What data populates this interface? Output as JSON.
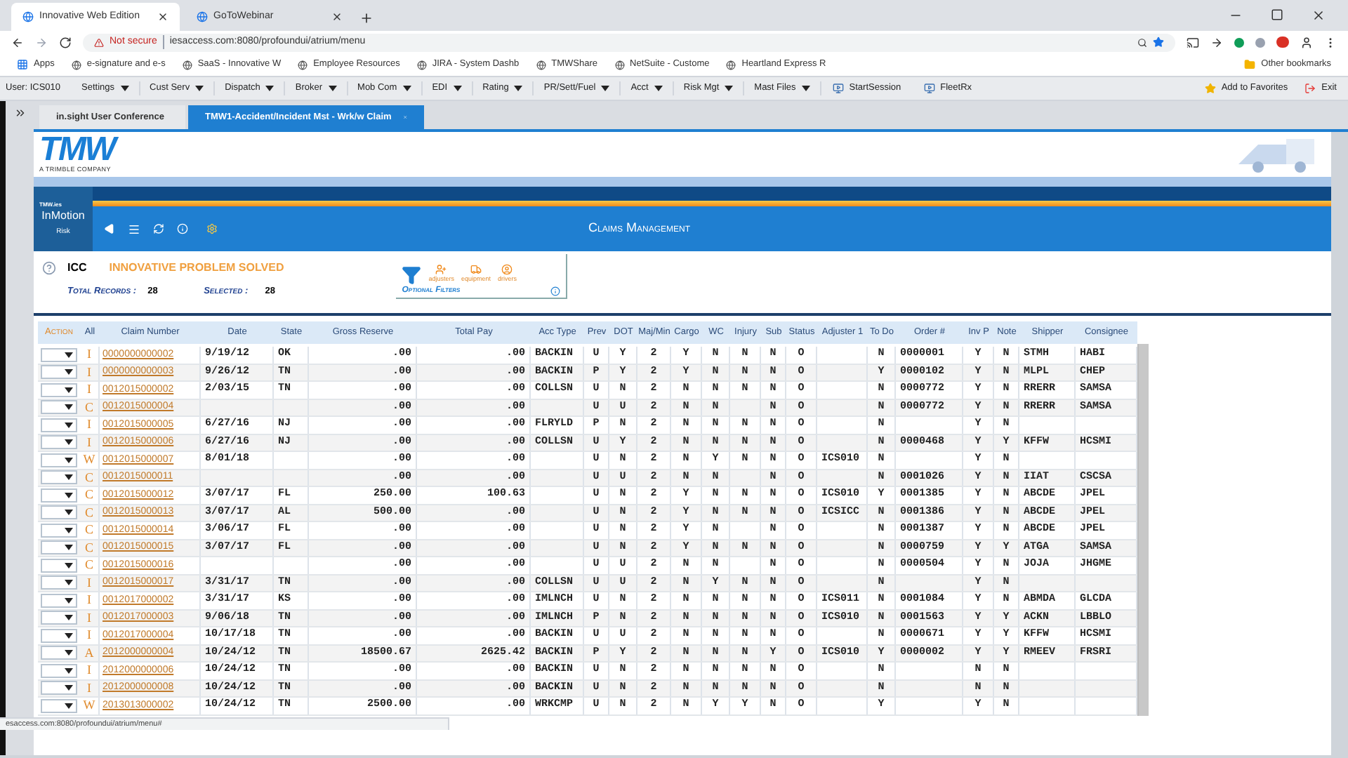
{
  "browser": {
    "tabs": [
      {
        "label": "Innovative Web Edition",
        "selected": true
      },
      {
        "label": "GoToWebinar",
        "selected": false
      }
    ],
    "security": "Not secure",
    "url": "iesaccess.com:8080/profoundui/atrium/menu",
    "bookmarks": [
      "Apps",
      "e-signature and e-s",
      "SaaS - Innovative W",
      "Employee Resources",
      "JIRA - System Dashb",
      "TMWShare",
      "NetSuite - Custome",
      "Heartland Express R"
    ],
    "other_bookmarks": "Other bookmarks",
    "status_url": "esaccess.com:8080/profoundui/atrium/menu#"
  },
  "menu_bar": {
    "user": "User: ICS010",
    "items": [
      {
        "label": "Settings",
        "has_menu": true
      },
      {
        "label": "Cust Serv",
        "has_menu": true
      },
      {
        "label": "Dispatch",
        "has_menu": true
      },
      {
        "label": "Broker",
        "has_menu": true
      },
      {
        "label": "Mob Com",
        "has_menu": true
      },
      {
        "label": "EDI",
        "has_menu": true
      },
      {
        "label": "Rating",
        "has_menu": true
      },
      {
        "label": "PR/Sett/Fuel",
        "has_menu": true
      },
      {
        "label": "Acct",
        "has_menu": true
      },
      {
        "label": "Risk Mgt",
        "has_menu": true
      },
      {
        "label": "Mast Files",
        "has_menu": true
      }
    ],
    "links": [
      "StartSession",
      "FleetRx"
    ],
    "favorites": "Add to Favorites",
    "exit": "Exit"
  },
  "app_tabs": [
    {
      "label": "in.sight User Conference",
      "selected": false
    },
    {
      "label": "TMW1-Accident/Incident Mst - Wrk/w Claim",
      "selected": true
    }
  ],
  "header": {
    "logo": "TMW",
    "logo_tagline": "A TRIMBLE COMPANY",
    "module_brand": "TMW.ies",
    "module_name": "InMotion",
    "module_sub": "Risk",
    "title": "Claims Management"
  },
  "summary": {
    "code": "ICC",
    "company": "INNOVATIVE PROBLEM SOLVED",
    "total_label": "Total Records :",
    "total": "28",
    "selected_label": "Selected :",
    "selected": "28"
  },
  "filters": {
    "items": [
      "adjusters",
      "equipment",
      "drivers"
    ],
    "label": "Optional Filters"
  },
  "table": {
    "columns": [
      "Action",
      "All",
      "Claim Number",
      "Date",
      "State",
      "Gross Reserve",
      "Total Pay",
      "Acc Type",
      "Prev",
      "DOT",
      "Maj/Min",
      "Cargo",
      "WC",
      "Injury",
      "Sub",
      "Status",
      "Adjuster 1",
      "To Do",
      "Order #",
      "Inv P",
      "Note",
      "Shipper",
      "Consignee"
    ],
    "rows": [
      {
        "cells": [
          "",
          "I",
          "0000000000002",
          "9/19/12",
          "OK",
          ".00",
          ".00",
          "BACKIN",
          "U",
          "Y",
          "2",
          "Y",
          "N",
          "N",
          "N",
          "O",
          "",
          "N",
          "0000001",
          "Y",
          "N",
          "STMH",
          "HABI"
        ]
      },
      {
        "cells": [
          "",
          "I",
          "0000000000003",
          "9/26/12",
          "TN",
          ".00",
          ".00",
          "BACKIN",
          "P",
          "Y",
          "2",
          "Y",
          "N",
          "N",
          "N",
          "O",
          "",
          "Y",
          "0000102",
          "Y",
          "N",
          "MLPL",
          "CHEP"
        ]
      },
      {
        "cells": [
          "",
          "I",
          "0012015000002",
          "2/03/15",
          "TN",
          ".00",
          ".00",
          "COLLSN",
          "U",
          "N",
          "2",
          "N",
          "N",
          "N",
          "N",
          "O",
          "",
          "N",
          "0000772",
          "Y",
          "N",
          "RRERR",
          "SAMSA"
        ]
      },
      {
        "cells": [
          "",
          "C",
          "0012015000004",
          "",
          "",
          ".00",
          ".00",
          "",
          "U",
          "U",
          "2",
          "N",
          "N",
          "",
          "N",
          "O",
          "",
          "N",
          "0000772",
          "Y",
          "N",
          "RRERR",
          "SAMSA"
        ]
      },
      {
        "cells": [
          "",
          "I",
          "0012015000005",
          "6/27/16",
          "NJ",
          ".00",
          ".00",
          "FLRYLD",
          "P",
          "N",
          "2",
          "N",
          "N",
          "N",
          "N",
          "O",
          "",
          "N",
          "",
          "Y",
          "N",
          "",
          ""
        ]
      },
      {
        "cells": [
          "",
          "I",
          "0012015000006",
          "6/27/16",
          "NJ",
          ".00",
          ".00",
          "COLLSN",
          "U",
          "Y",
          "2",
          "N",
          "N",
          "N",
          "N",
          "O",
          "",
          "N",
          "0000468",
          "Y",
          "Y",
          "KFFW",
          "HCSMI"
        ]
      },
      {
        "cells": [
          "",
          "W",
          "0012015000007",
          "8/01/18",
          "",
          ".00",
          ".00",
          "",
          "U",
          "N",
          "2",
          "N",
          "Y",
          "N",
          "N",
          "O",
          "ICS010",
          "N",
          "",
          "Y",
          "N",
          "",
          ""
        ]
      },
      {
        "cells": [
          "",
          "C",
          "0012015000011",
          "",
          "",
          ".00",
          ".00",
          "",
          "U",
          "U",
          "2",
          "N",
          "N",
          "",
          "N",
          "O",
          "",
          "N",
          "0001026",
          "Y",
          "N",
          "IIAT",
          "CSCSA"
        ]
      },
      {
        "cells": [
          "",
          "C",
          "0012015000012",
          "3/07/17",
          "FL",
          "250.00",
          "100.63",
          "",
          "U",
          "N",
          "2",
          "Y",
          "N",
          "N",
          "N",
          "O",
          "ICS010",
          "Y",
          "0001385",
          "Y",
          "N",
          "ABCDE",
          "JPEL"
        ]
      },
      {
        "cells": [
          "",
          "C",
          "0012015000013",
          "3/07/17",
          "AL",
          "500.00",
          ".00",
          "",
          "U",
          "N",
          "2",
          "Y",
          "N",
          "N",
          "N",
          "O",
          "ICSICC",
          "N",
          "0001386",
          "Y",
          "N",
          "ABCDE",
          "JPEL"
        ]
      },
      {
        "cells": [
          "",
          "C",
          "0012015000014",
          "3/06/17",
          "FL",
          ".00",
          ".00",
          "",
          "U",
          "N",
          "2",
          "Y",
          "N",
          "",
          "N",
          "O",
          "",
          "N",
          "0001387",
          "Y",
          "N",
          "ABCDE",
          "JPEL"
        ]
      },
      {
        "cells": [
          "",
          "C",
          "0012015000015",
          "3/07/17",
          "FL",
          ".00",
          ".00",
          "",
          "U",
          "N",
          "2",
          "Y",
          "N",
          "N",
          "N",
          "O",
          "",
          "N",
          "0000759",
          "Y",
          "Y",
          "ATGA",
          "SAMSA"
        ]
      },
      {
        "cells": [
          "",
          "C",
          "0012015000016",
          "",
          "",
          ".00",
          ".00",
          "",
          "U",
          "U",
          "2",
          "N",
          "N",
          "",
          "N",
          "O",
          "",
          "N",
          "0000504",
          "Y",
          "N",
          "JOJA",
          "JHGME"
        ]
      },
      {
        "cells": [
          "",
          "I",
          "0012015000017",
          "3/31/17",
          "TN",
          ".00",
          ".00",
          "COLLSN",
          "U",
          "U",
          "2",
          "N",
          "Y",
          "N",
          "N",
          "O",
          "",
          "N",
          "",
          "Y",
          "N",
          "",
          ""
        ]
      },
      {
        "cells": [
          "",
          "I",
          "0012017000002",
          "3/31/17",
          "KS",
          ".00",
          ".00",
          "IMLNCH",
          "U",
          "N",
          "2",
          "N",
          "N",
          "N",
          "N",
          "O",
          "ICS011",
          "N",
          "0001084",
          "Y",
          "N",
          "ABMDA",
          "GLCDA"
        ]
      },
      {
        "cells": [
          "",
          "I",
          "0012017000003",
          "9/06/18",
          "TN",
          ".00",
          ".00",
          "IMLNCH",
          "P",
          "N",
          "2",
          "N",
          "N",
          "N",
          "N",
          "O",
          "ICS010",
          "N",
          "0001563",
          "Y",
          "Y",
          "ACKN",
          "LBBLO"
        ]
      },
      {
        "cells": [
          "",
          "I",
          "0012017000004",
          "10/17/18",
          "TN",
          ".00",
          ".00",
          "BACKIN",
          "U",
          "U",
          "2",
          "N",
          "N",
          "N",
          "N",
          "O",
          "",
          "N",
          "0000671",
          "Y",
          "Y",
          "KFFW",
          "HCSMI"
        ]
      },
      {
        "cells": [
          "",
          "A",
          "2012000000004",
          "10/24/12",
          "TN",
          "18500.67",
          "2625.42",
          "BACKIN",
          "P",
          "Y",
          "2",
          "N",
          "N",
          "N",
          "Y",
          "O",
          "ICS010",
          "Y",
          "0000002",
          "Y",
          "Y",
          "RMEEV",
          "FRSRI"
        ]
      },
      {
        "cells": [
          "",
          "I",
          "2012000000006",
          "10/24/12",
          "TN",
          ".00",
          ".00",
          "BACKIN",
          "U",
          "N",
          "2",
          "N",
          "N",
          "N",
          "N",
          "O",
          "",
          "N",
          "",
          "N",
          "N",
          "",
          ""
        ]
      },
      {
        "cells": [
          "",
          "I",
          "2012000000008",
          "10/24/12",
          "TN",
          ".00",
          ".00",
          "BACKIN",
          "U",
          "N",
          "2",
          "N",
          "N",
          "N",
          "N",
          "O",
          "",
          "N",
          "",
          "N",
          "N",
          "",
          ""
        ]
      },
      {
        "cells": [
          "",
          "W",
          "2013013000002",
          "10/24/12",
          "TN",
          "2500.00",
          ".00",
          "WRKCMP",
          "U",
          "N",
          "2",
          "N",
          "Y",
          "Y",
          "N",
          "O",
          "",
          "Y",
          "",
          "Y",
          "N",
          "",
          ""
        ]
      }
    ]
  }
}
